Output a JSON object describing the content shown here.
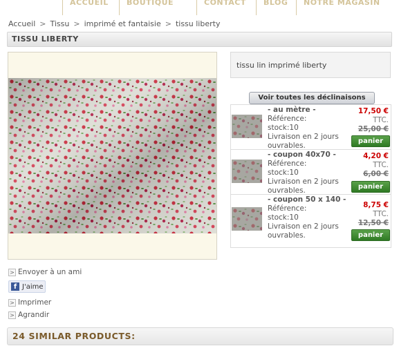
{
  "topnav": {
    "items": [
      "ACCUEIL",
      "BOUTIQUE",
      "CONTACT",
      "BLOG",
      "NOTRE MAGASIN"
    ]
  },
  "breadcrumb": [
    "Accueil",
    "Tissu",
    "imprimé et fantaisie",
    "tissu liberty"
  ],
  "breadcrumb_separator": ">",
  "page_title": "TISSU LIBERTY",
  "short_description": "tissu lin imprimé liberty",
  "declinations_button": "Voir toutes les déclinaisons",
  "variants": [
    {
      "name": "- au mètre -",
      "reference": "Référence:",
      "stock": "stock:10",
      "delivery": "Livraison en 2 jours ouvrables.",
      "price": "17,50 €",
      "tax": "TTC.",
      "old_price": "25,00 €",
      "cart": "panier"
    },
    {
      "name": "- coupon 40x70 -",
      "reference": "Référence:",
      "stock": "stock:10",
      "delivery": "Livraison en 2 jours ouvrables.",
      "price": "4,20 €",
      "tax": "TTC.",
      "old_price": "6,00 €",
      "cart": "panier"
    },
    {
      "name": "- coupon 50 x 140 -",
      "reference": "Référence:",
      "stock": "stock:10",
      "delivery": "Livraison en 2 jours ouvrables.",
      "price": "8,75 €",
      "tax": "TTC.",
      "old_price": "12,50 €",
      "cart": "panier"
    }
  ],
  "actions": {
    "send_friend": "Envoyer à un ami",
    "like": "J'aime",
    "print": "Imprimer",
    "enlarge": "Agrandir"
  },
  "similar_heading": "24 SIMILAR PRODUCTS:",
  "colors": {
    "price": "#cc0000",
    "cart_button": "#3d8a2f",
    "accent_heading": "#7a5a2a"
  }
}
